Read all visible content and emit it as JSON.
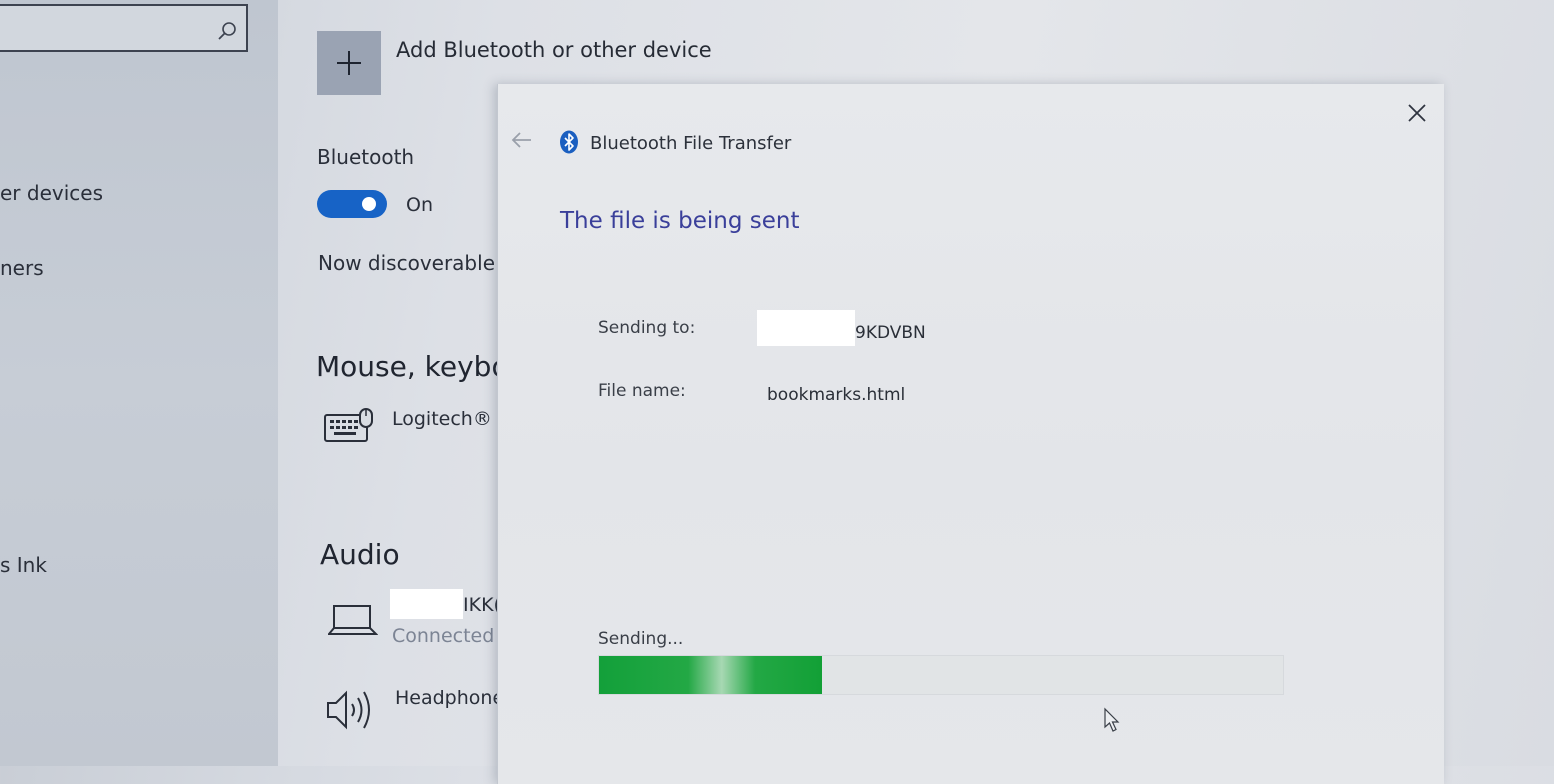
{
  "nav": {
    "search_placeholder": "",
    "items": [
      "er devices",
      "ners",
      "s Ink"
    ]
  },
  "main": {
    "add_device_label": "Add Bluetooth or other device",
    "bluetooth_heading": "Bluetooth",
    "bluetooth_toggle": {
      "state": "On",
      "on": true
    },
    "discoverable_text": "Now discoverable",
    "sections": {
      "mouse_keyboard": {
        "title": "Mouse, keybo",
        "device_name": "Logitech®"
      },
      "audio": {
        "title": "Audio",
        "device1_name_suffix": "IKK(",
        "device1_status": "Connected",
        "device2_name": "Headphone"
      }
    }
  },
  "dialog": {
    "title": "Bluetooth File Transfer",
    "heading": "The file is being sent",
    "sending_to_label": "Sending to:",
    "sending_to_value_suffix": "9KDVBN",
    "file_name_label": "File name:",
    "file_name_value": "bookmarks.html",
    "progress_label": "Sending...",
    "progress_fraction": 0.326
  },
  "colors": {
    "accent": "#1763c6",
    "heading": "#3a3f9a",
    "progress": "#13a03a"
  },
  "icons": [
    "search-icon",
    "plus-icon",
    "keyboard-icon",
    "laptop-icon",
    "speaker-icon",
    "bluetooth-icon",
    "back-arrow-icon",
    "close-icon",
    "mouse-cursor-icon"
  ]
}
